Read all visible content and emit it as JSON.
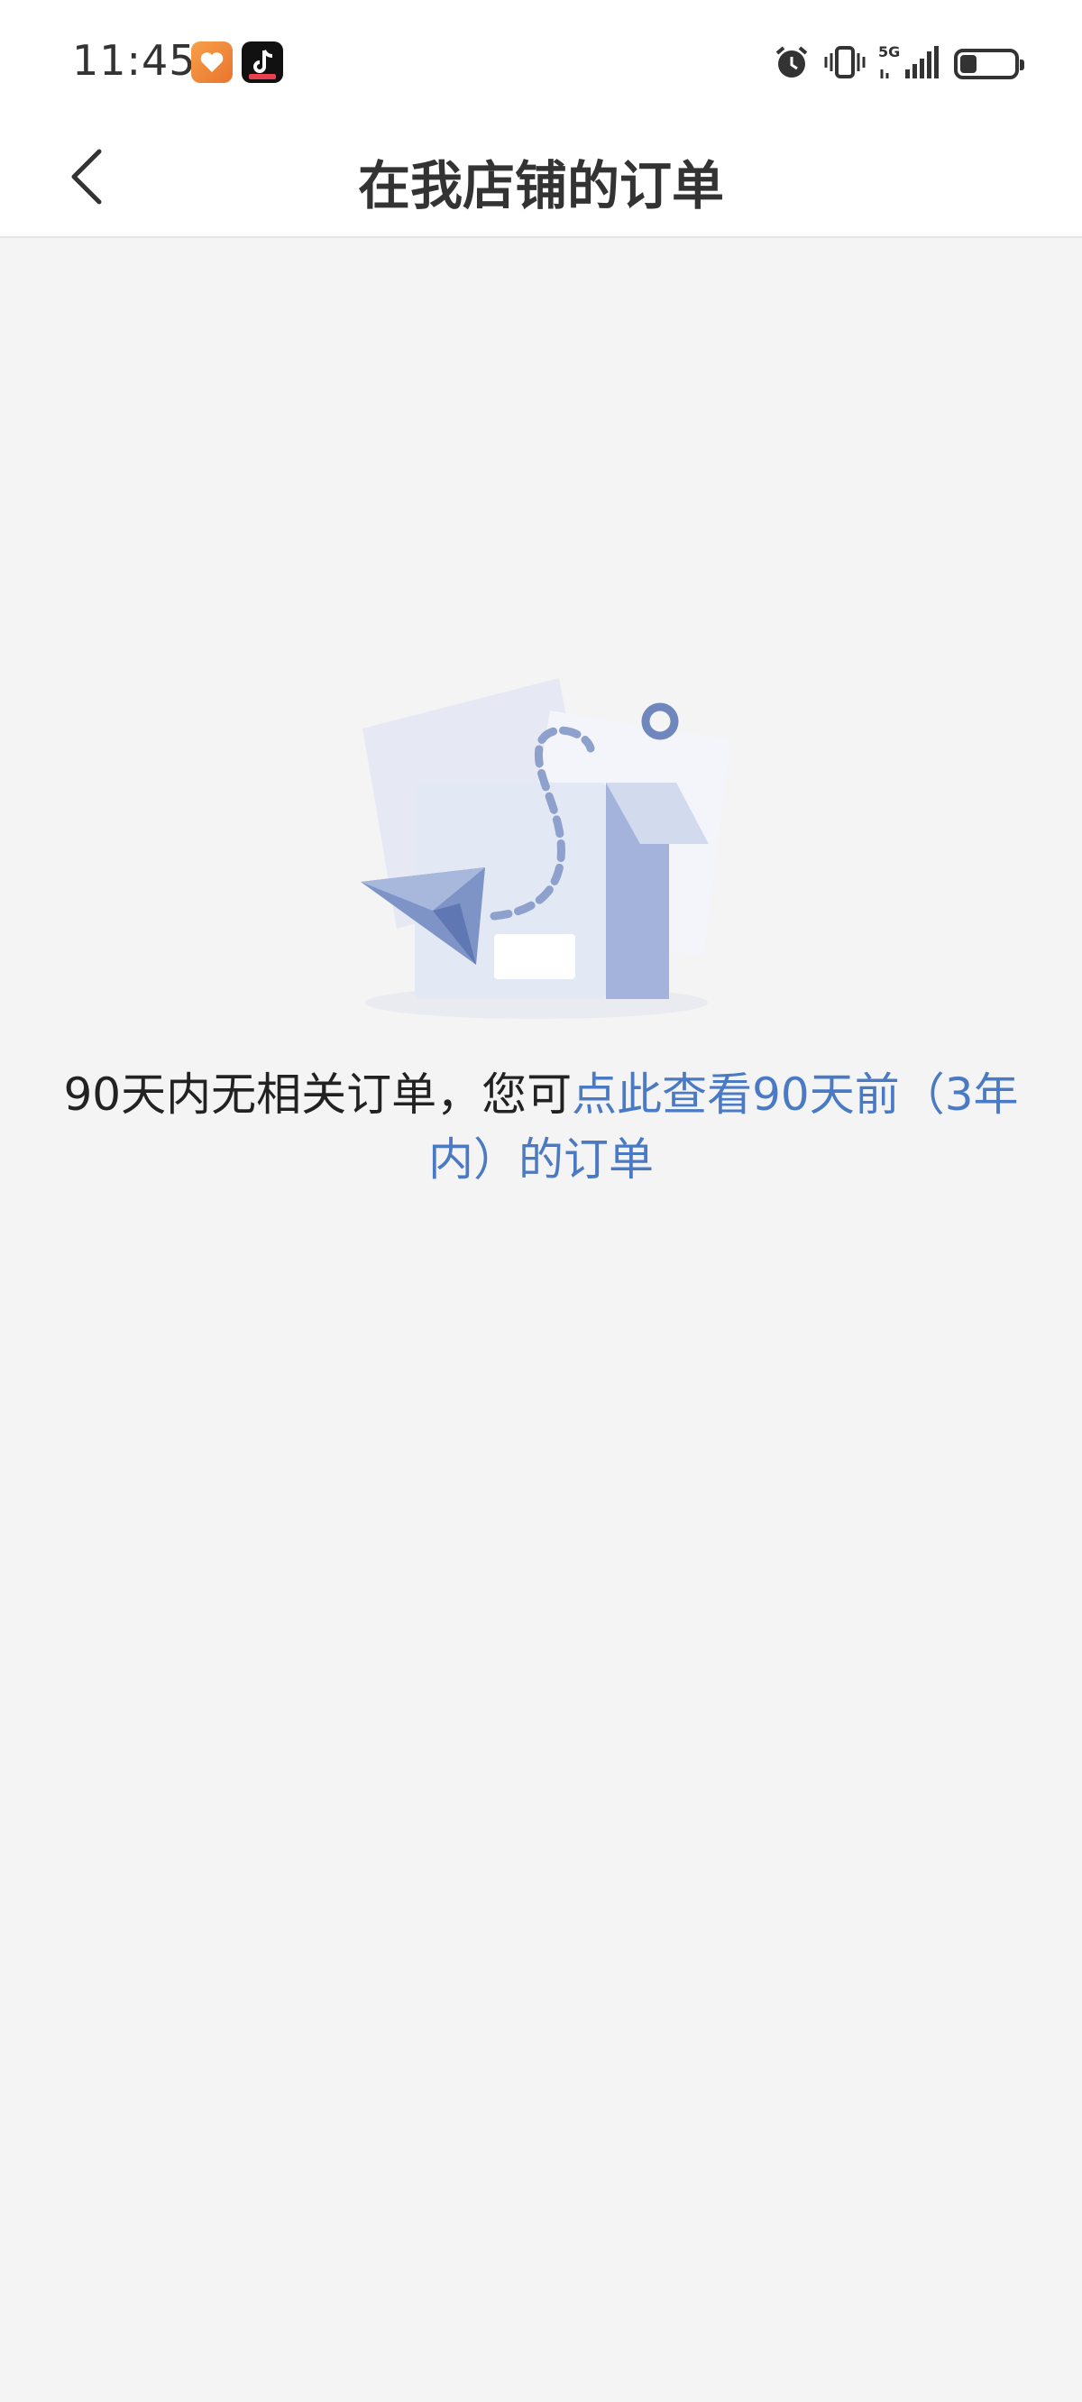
{
  "status_bar": {
    "time": "11:45",
    "icons": [
      "health-app-icon",
      "tiktok-app-icon",
      "alarm-icon",
      "vibrate-icon",
      "5g-signal-icon",
      "battery-icon"
    ],
    "network_label": "5G"
  },
  "header": {
    "title": "在我店铺的订单",
    "back_icon": "chevron-left-icon"
  },
  "empty_state": {
    "message_prefix": "90天内无相关订单，您可",
    "link_text": "点此查看90天前（3年内）的订单",
    "illustration_icon": "empty-box-paper-plane-icon",
    "link_color": "#4a7ac4"
  },
  "colors": {
    "background": "#f4f4f4",
    "header_bg": "#ffffff",
    "accent": "#4a7ac4",
    "text": "#222222"
  }
}
